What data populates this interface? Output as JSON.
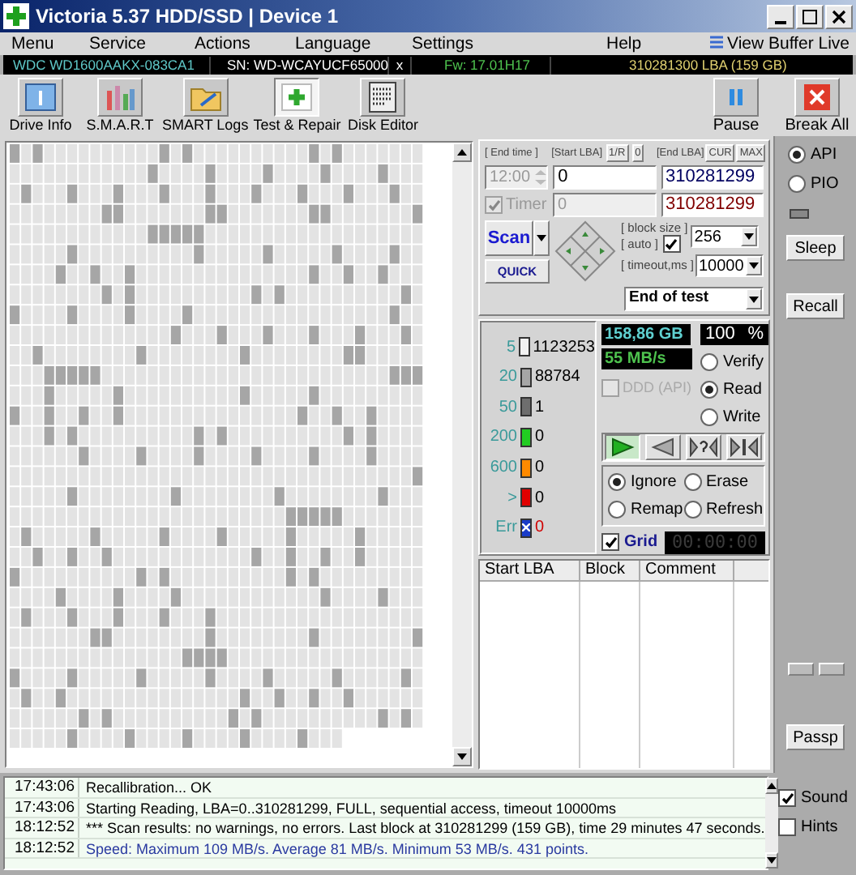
{
  "window": {
    "title": "Victoria 5.37 HDD/SSD | Device 1"
  },
  "menu": {
    "items": [
      "Menu",
      "Service",
      "Actions",
      "Language",
      "Settings",
      "Help"
    ],
    "view_buffer": "View Buffer Live"
  },
  "drive_bar": {
    "model": "WDC WD1600AAKX-083CA1",
    "serial": "SN: WD-WCAYUCF65000",
    "close": "x",
    "firmware": "Fw: 17.01H17",
    "capacity": "310281300 LBA (159 GB)"
  },
  "toolbar": {
    "buttons": [
      {
        "label": "Drive Info",
        "kind": "info",
        "selected": false
      },
      {
        "label": "S.M.A.R.T",
        "kind": "smart",
        "selected": false
      },
      {
        "label": "SMART Logs",
        "kind": "logs",
        "selected": false
      },
      {
        "label": "Test & Repair",
        "kind": "test",
        "selected": true
      },
      {
        "label": "Disk Editor",
        "kind": "editor",
        "selected": false
      }
    ],
    "right_buttons": [
      {
        "label": "Pause",
        "kind": "pause"
      },
      {
        "label": "Break All",
        "kind": "break"
      }
    ]
  },
  "scan": {
    "end_time_label": "[ End time ]",
    "end_time": "12:00",
    "timer": {
      "label": "Timer",
      "checked": true
    },
    "start_lba_label": "[Start LBA]",
    "start_buttons": [
      "1/R",
      "0"
    ],
    "start_lba": "0",
    "start_lba_2": "0",
    "end_lba_label": "[End LBA]",
    "end_buttons": [
      "CUR",
      "MAX"
    ],
    "end_lba": "310281299",
    "end_lba_2": "310281299",
    "scan_button": "Scan",
    "quick_button": "QUICK",
    "block_size_label": "[ block size ]",
    "auto_label": "[ auto ]",
    "auto_checked": true,
    "block_size": "256",
    "timeout_label": "[ timeout,ms ]",
    "timeout": "10000",
    "end_action": "End of test"
  },
  "legend": [
    {
      "label": "5",
      "count": "1123253",
      "color": "#f2f2f2",
      "kind": "normal"
    },
    {
      "label": "20",
      "count": "88784",
      "color": "#a6a6a6",
      "kind": "normal"
    },
    {
      "label": "50",
      "count": "1",
      "color": "#6e6e6e",
      "kind": "normal"
    },
    {
      "label": "200",
      "count": "0",
      "color": "#22cc22",
      "kind": "normal"
    },
    {
      "label": "600",
      "count": "0",
      "color": "#ff8a00",
      "kind": "normal"
    },
    {
      "label": ">",
      "count": "0",
      "color": "#e00000",
      "kind": "normal"
    },
    {
      "label": "Err",
      "count": "0",
      "color": "#1a3cc8",
      "kind": "error"
    }
  ],
  "stats": {
    "size": "158,86 GB",
    "percent": "100",
    "percent_unit": "%",
    "speed": "55 MB/s",
    "ddd": {
      "label": "DDD (API)",
      "checked": false
    },
    "modes": [
      {
        "label": "Verify",
        "selected": false
      },
      {
        "label": "Read",
        "selected": true
      },
      {
        "label": "Write",
        "selected": false
      }
    ]
  },
  "player": [
    {
      "kind": "play",
      "selected": true
    },
    {
      "kind": "back",
      "selected": false
    },
    {
      "kind": "unknown",
      "selected": false
    },
    {
      "kind": "end",
      "selected": false
    }
  ],
  "actions": [
    {
      "label": "Ignore",
      "selected": true
    },
    {
      "label": "Erase",
      "selected": false
    },
    {
      "label": "Remap",
      "selected": false
    },
    {
      "label": "Refresh",
      "selected": false
    }
  ],
  "grid": {
    "label": "Grid",
    "checked": true
  },
  "timer_display": "00:00:00",
  "table": {
    "columns": [
      "Start LBA",
      "Block",
      "Comment"
    ]
  },
  "side": {
    "modes": [
      {
        "label": "API",
        "selected": true
      },
      {
        "label": "PIO",
        "selected": false
      }
    ],
    "buttons": [
      "Sleep",
      "Recall"
    ],
    "bottom_button": "Passp"
  },
  "log": {
    "rows": [
      {
        "time": "17:43:06",
        "text": "Recallibration... OK",
        "kind": "info"
      },
      {
        "time": "17:43:06",
        "text": "Starting Reading, LBA=0..310281299, FULL, sequential access, timeout 10000ms",
        "kind": "info"
      },
      {
        "time": "18:12:52",
        "text": "*** Scan results: no warnings, no errors. Last block at 310281299 (159 GB), time 29 minutes 47 seconds.",
        "kind": "info"
      },
      {
        "time": "18:12:52",
        "text": "Speed: Maximum 109 MB/s. Average 81 MB/s. Minimum 53 MB/s. 431 points.",
        "kind": "speed"
      }
    ],
    "options": [
      {
        "label": "Sound",
        "checked": true
      },
      {
        "label": "Hints",
        "checked": false
      }
    ]
  }
}
